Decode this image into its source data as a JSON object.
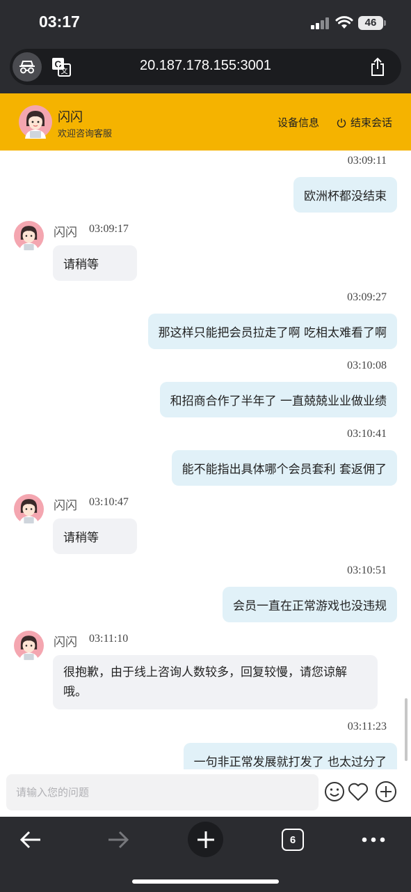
{
  "status_bar": {
    "time": "03:17",
    "battery": "46"
  },
  "browser": {
    "url": "20.187.178.155:3001",
    "tab_count": "6"
  },
  "header": {
    "agent_name": "闪闪",
    "subtitle": "欢迎咨询客服",
    "device_info": "设备信息",
    "end_session": "结束会话",
    "accent_color": "#f5b300"
  },
  "chat": {
    "messages": [
      {
        "from": "user",
        "time": "03:09:11",
        "text": "欧洲杯都没结束"
      },
      {
        "from": "agent",
        "name": "闪闪",
        "time": "03:09:17",
        "text": "请稍等"
      },
      {
        "from": "user",
        "time": "03:09:27",
        "text": "那这样只能把会员拉走了啊 吃相太难看了啊"
      },
      {
        "from": "user",
        "time": "03:10:08",
        "text": "和招商合作了半年了 一直兢兢业业做业绩"
      },
      {
        "from": "user",
        "time": "03:10:41",
        "text": "能不能指出具体哪个会员套利 套返佣了"
      },
      {
        "from": "agent",
        "name": "闪闪",
        "time": "03:10:47",
        "text": "请稍等"
      },
      {
        "from": "user",
        "time": "03:10:51",
        "text": "会员一直在正常游戏也没违规"
      },
      {
        "from": "agent",
        "name": "闪闪",
        "time": "03:11:10",
        "text": "很抱歉，由于线上咨询人数较多，回复较慢，请您谅解哦。"
      },
      {
        "from": "user",
        "time": "03:11:23",
        "text": "一句非正常发展就打发了 也太过分了"
      }
    ]
  },
  "composer": {
    "placeholder": "请输入您的问题",
    "value": "",
    "icons": [
      "emoji-icon",
      "heart-icon",
      "plus-icon"
    ]
  },
  "toolbar": {
    "icons": [
      "back-arrow-icon",
      "forward-arrow-icon",
      "new-tab-plus-icon",
      "tabs-icon",
      "more-icon"
    ]
  }
}
